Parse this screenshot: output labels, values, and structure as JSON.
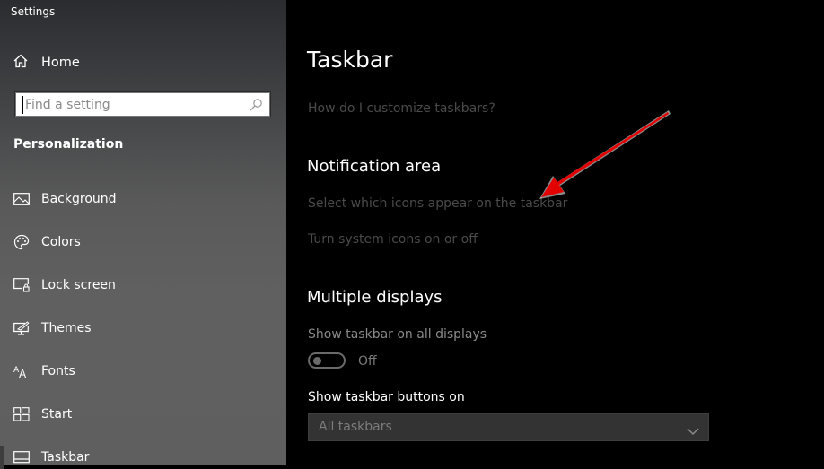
{
  "window": {
    "title": "Settings"
  },
  "sidebar": {
    "home_label": "Home",
    "search": {
      "placeholder": "Find a setting",
      "value": ""
    },
    "section_title": "Personalization",
    "items": [
      {
        "label": "Background",
        "icon": "background-image-icon"
      },
      {
        "label": "Colors",
        "icon": "palette-icon"
      },
      {
        "label": "Lock screen",
        "icon": "lock-screen-icon"
      },
      {
        "label": "Themes",
        "icon": "themes-icon"
      },
      {
        "label": "Fonts",
        "icon": "fonts-icon"
      },
      {
        "label": "Start",
        "icon": "start-icon"
      },
      {
        "label": "Taskbar",
        "icon": "taskbar-icon",
        "active": true
      }
    ]
  },
  "main": {
    "title": "Taskbar",
    "help_link": "How do I customize taskbars?",
    "notification_area": {
      "heading": "Notification area",
      "links": [
        "Select which icons appear on the taskbar",
        "Turn system icons on or off"
      ]
    },
    "multiple_displays": {
      "heading": "Multiple displays",
      "show_all_label": "Show taskbar on all displays",
      "toggle_state": "Off",
      "toggle_on": false,
      "buttons_on_label": "Show taskbar buttons on",
      "buttons_on_value": "All taskbars"
    }
  },
  "annotation": {
    "type": "red-arrow",
    "color": "#e30000",
    "points_to": "Select which icons appear on the taskbar"
  }
}
